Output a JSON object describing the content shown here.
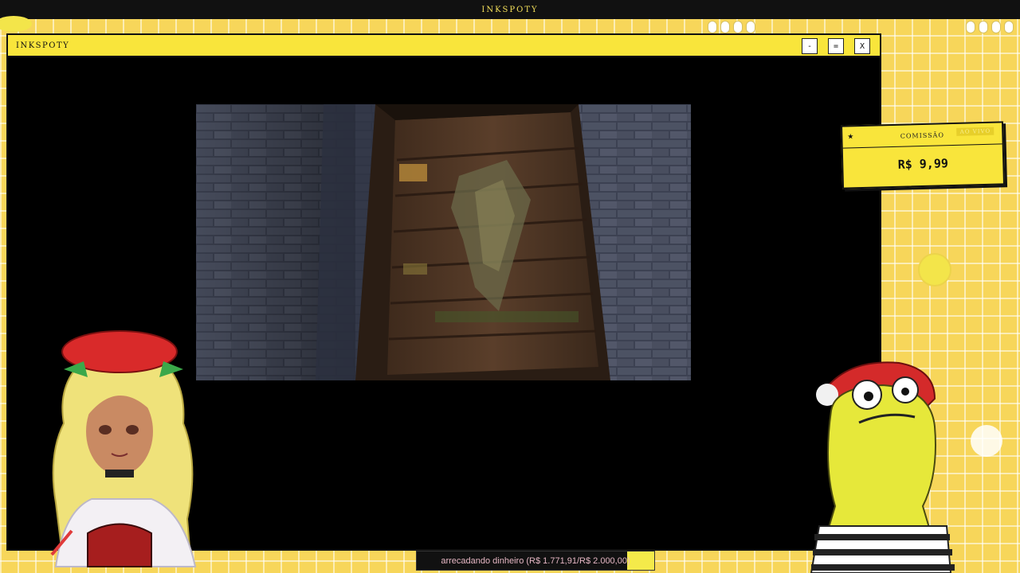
{
  "app": {
    "title": "INKSPOTY"
  },
  "window": {
    "title": "INKSPOTY",
    "minimize_label": "-",
    "maximize_label": "=",
    "close_label": "X"
  },
  "commission": {
    "label": "COMISSÃO",
    "badge": "AO VIVO",
    "price": "R$ 9,99",
    "star": "★"
  },
  "goal": {
    "text": "arrecadando dinheiro (R$ 1.771,91/R$ 2.000,00)",
    "raised": 1771.91,
    "target": 2000.0
  },
  "colors": {
    "accent_yellow": "#f9e53b",
    "background_yellow": "#f7d65a",
    "frame_black": "#000000",
    "goal_text": "#e6b7c4"
  },
  "icons": {
    "star": "star-icon"
  }
}
